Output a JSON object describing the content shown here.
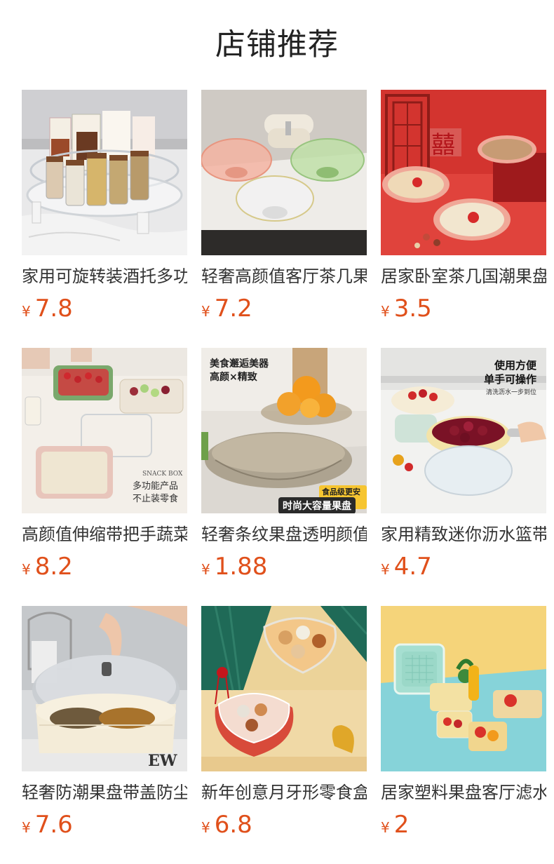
{
  "header": {
    "title": "店铺推荐"
  },
  "currency": "¥",
  "products": [
    {
      "name": "家用可旋转装酒托多功能收纳",
      "price": "7.8",
      "image": "rotating-storage-tray-photo"
    },
    {
      "name": "轻奢高颜值客厅茶几果盘",
      "price": "7.2",
      "image": "glass-fruit-bowls-photo"
    },
    {
      "name": "居家卧室茶几国潮果盘",
      "price": "3.5",
      "image": "red-wedding-nut-plates-photo"
    },
    {
      "name": "高颜值伸缩带把手蔬菜沥水篮",
      "price": "8.2",
      "image": "extendable-drain-basket-photo",
      "overlay": {
        "brand": "SNACK BOX",
        "line1": "多功能产品",
        "line2": "不止装零食"
      }
    },
    {
      "name": "轻奢条纹果盘透明颜值果盘",
      "price": "1.88",
      "image": "striped-fruit-bowl-photo",
      "overlay": {
        "line1": "美食邂逅美器",
        "line2": "高颜×精致",
        "tag_small": "食品级更安全",
        "tag_big": "时尚大容量果盘"
      }
    },
    {
      "name": "家用精致迷你沥水篮带手柄",
      "price": "4.7",
      "image": "mini-strainer-photo",
      "overlay": {
        "line1": "使用方便",
        "line2": "单手可操作",
        "line3": "清洗沥水一步到位"
      }
    },
    {
      "name": "轻奢防潮果盘带盖防尘干果盒",
      "price": "7.6",
      "image": "lidded-snack-box-photo"
    },
    {
      "name": "新年创意月牙形零食盒",
      "price": "6.8",
      "image": "flower-candy-box-photo"
    },
    {
      "name": "居家塑料果盘客厅滤水篮",
      "price": "2",
      "image": "plastic-drain-baskets-photo"
    }
  ],
  "colors": {
    "price": "#e0501b",
    "title": "#222222"
  }
}
